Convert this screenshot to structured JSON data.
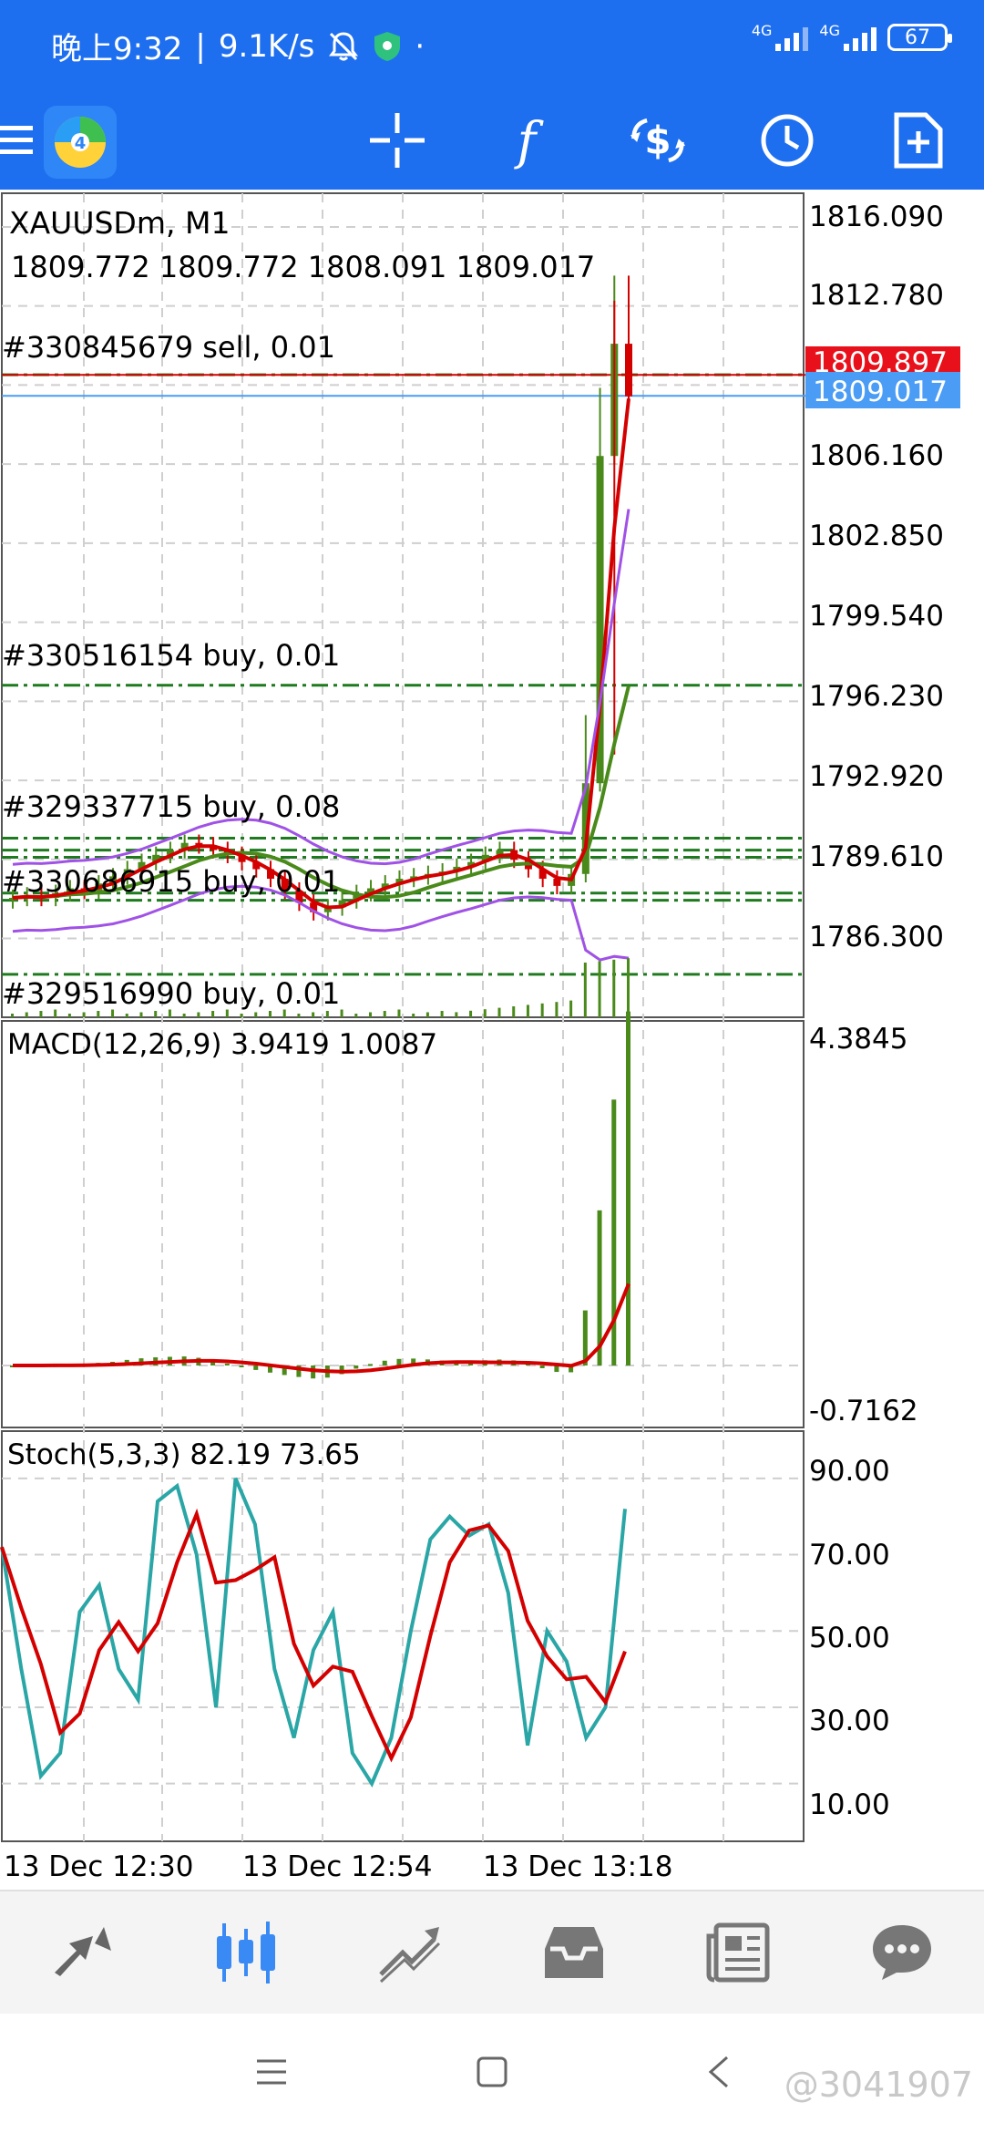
{
  "status_bar": {
    "time": "晚上9:32",
    "speed": "9.1K/s",
    "sep": "|",
    "dot": "·",
    "net1": "4G",
    "net2": "4G",
    "battery": "67"
  },
  "toolbar": {
    "menu_icon": "menu-icon",
    "app_icon": "metatrader-logo",
    "crosshair_icon": "crosshair-icon",
    "indicators_icon": "function-icon",
    "trade_icon": "dollar-exchange-icon",
    "timeframe_icon": "clock-icon",
    "new_order_icon": "document-plus-icon"
  },
  "colors": {
    "accent": "#1e6ff0",
    "bull": "#4a8a1a",
    "bear": "#d40000",
    "bollinger": "#a052e6",
    "stoch_main": "#2aa6a6",
    "ask_line": "#d40000",
    "bid_line": "#4a9cf5"
  },
  "chart": {
    "symbol": "XAUUSDm, M1",
    "ohlc": "1809.772 1809.772 1808.091 1809.017",
    "price_labels": [
      "1816.090",
      "1812.780",
      "1806.160",
      "1802.850",
      "1799.540",
      "1796.230",
      "1792.920",
      "1789.610",
      "1786.300"
    ],
    "ask_price": "1809.897",
    "bid_price": "1809.017",
    "orders": [
      {
        "label": "#330845679 sell, 0.01",
        "price": 1809.9
      },
      {
        "label": "#330516154 buy, 0.01",
        "price": 1796.9
      },
      {
        "label": "#329337715 buy, 0.08",
        "price": 1790.5
      },
      {
        "label": "#330686915 buy, 0.01",
        "price": 1788.2
      },
      {
        "label": "#329516990 buy, 0.01",
        "price": 1784.8
      }
    ],
    "time_labels": [
      "13 Dec 12:30",
      "13 Dec 12:54",
      "13 Dec 13:18"
    ]
  },
  "macd": {
    "label": "MACD(12,26,9) 3.9419 1.0087",
    "top_label": "4.3845",
    "bottom_label": "-0.7162"
  },
  "stoch": {
    "label": "Stoch(5,3,3) 82.19 73.65",
    "levels": [
      "90.00",
      "70.00",
      "50.00",
      "30.00",
      "10.00"
    ]
  },
  "bottom_nav": {
    "quotes_icon": "quotes-arrows-icon",
    "chart_icon": "candlestick-icon",
    "trade_icon": "trend-line-icon",
    "history_icon": "inbox-icon",
    "news_icon": "newspaper-icon",
    "chat_icon": "chat-bubble-icon"
  },
  "sys_nav": {
    "watermark": "@3041907"
  }
}
